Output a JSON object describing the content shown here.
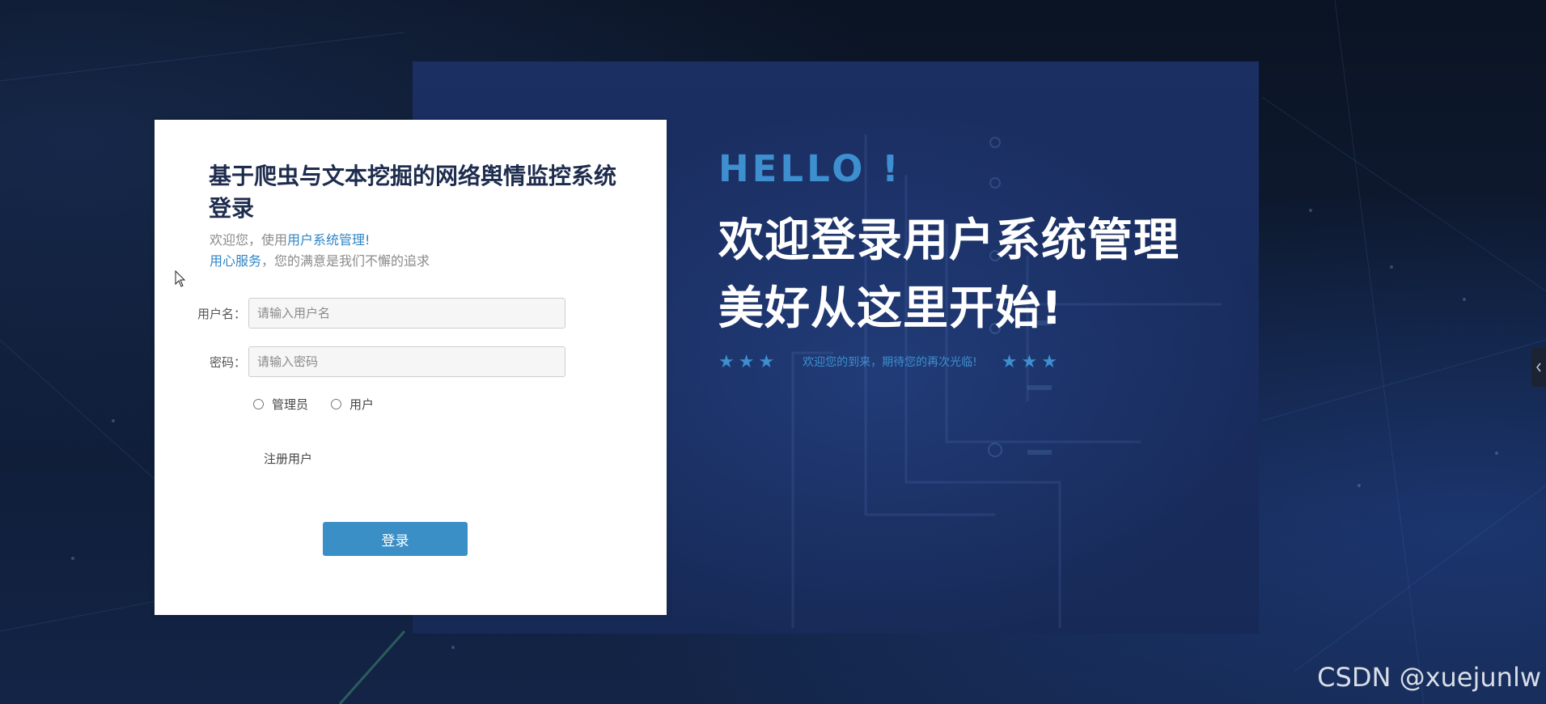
{
  "hero": {
    "hello": "HELLO !",
    "line1": "欢迎登录用户系统管理",
    "line2": "美好从这里开始!",
    "stars_left": "★★★",
    "tagline": "欢迎您的到来，期待您的再次光临!",
    "stars_right": "★★★"
  },
  "login": {
    "title": "基于爬虫与文本挖掘的网络舆情监控系统登录",
    "welcome_prefix": "欢迎您，使用",
    "welcome_highlight": "用户系统管理!",
    "service_highlight": "用心服务",
    "service_suffix": "，您的满意是我们不懈的追求",
    "username_label": "用户名：",
    "username_placeholder": "请输入用户名",
    "password_label": "密码：",
    "password_placeholder": "请输入密码",
    "role_options": [
      "管理员",
      "用户"
    ],
    "register_label": "注册用户",
    "login_button": "登录"
  },
  "watermark": "CSDN @xuejunlw",
  "colors": {
    "accent": "#3a8fc6",
    "title": "#1e2c4e",
    "hero_panel": "#1b2f63",
    "hello": "#3d8fd0"
  },
  "icons": {
    "cursor": "arrow-cursor-icon",
    "side_tab": "chevron-left-icon"
  }
}
